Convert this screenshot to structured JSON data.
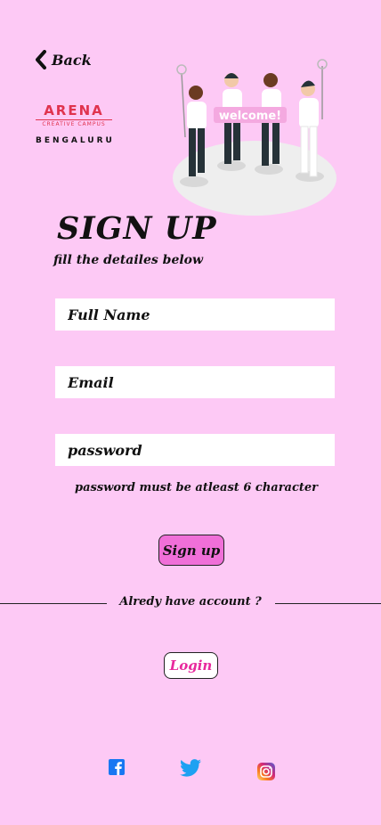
{
  "nav": {
    "back_label": "Back"
  },
  "logo": {
    "brand": "ARENA",
    "tagline": "CREATIVE CAMPUS",
    "city": "BENGALURU"
  },
  "illustration": {
    "banner_text": "welcome!"
  },
  "form": {
    "title": "SIGN UP",
    "subtitle": "fill the detailes below",
    "full_name_placeholder": "Full Name",
    "email_placeholder": "Email",
    "password_placeholder": "password",
    "password_hint": "password must be atleast 6 character",
    "submit_label": "Sign up"
  },
  "login_section": {
    "prompt": "Alredy have account ?",
    "login_label": "Login"
  },
  "social": {
    "icons": [
      "facebook-icon",
      "twitter-icon",
      "instagram-icon"
    ]
  },
  "colors": {
    "background": "#fdc9f5",
    "button_pink": "#f06fd8",
    "login_text": "#e8299d",
    "logo_red": "#e0334e"
  }
}
